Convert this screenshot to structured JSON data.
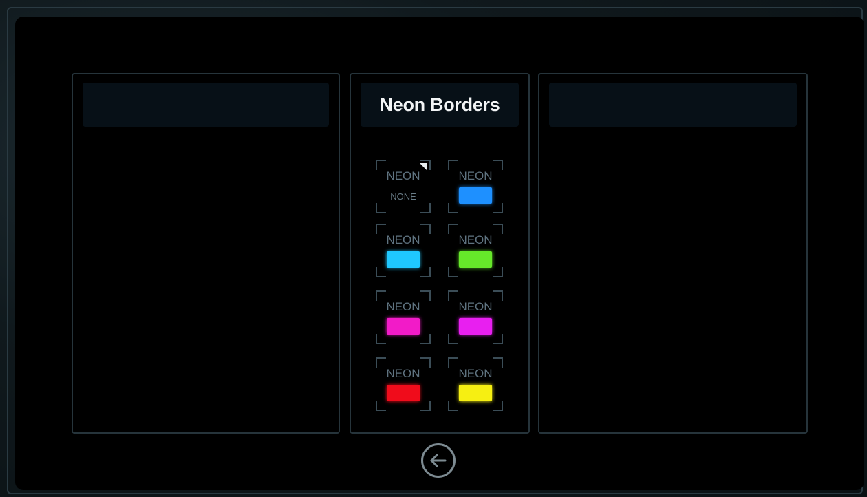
{
  "left_panel": {
    "title": ""
  },
  "center_panel": {
    "title": "Neon Borders",
    "tiles": [
      {
        "label": "NEON",
        "swatch": "NONE",
        "color": null,
        "selected": true
      },
      {
        "label": "NEON",
        "swatch": "",
        "color": "#1e90ff",
        "selected": false
      },
      {
        "label": "NEON",
        "swatch": "",
        "color": "#1fc8ff",
        "selected": false
      },
      {
        "label": "NEON",
        "swatch": "",
        "color": "#66e82a",
        "selected": false
      },
      {
        "label": "NEON",
        "swatch": "",
        "color": "#f21bc8",
        "selected": false
      },
      {
        "label": "NEON",
        "swatch": "",
        "color": "#e81ff0",
        "selected": false
      },
      {
        "label": "NEON",
        "swatch": "",
        "color": "#f00c1b",
        "selected": false
      },
      {
        "label": "NEON",
        "swatch": "",
        "color": "#f6ef12",
        "selected": false
      }
    ]
  },
  "right_panel": {
    "title": ""
  },
  "back_button": {
    "icon": "arrow-left-circle-icon"
  }
}
